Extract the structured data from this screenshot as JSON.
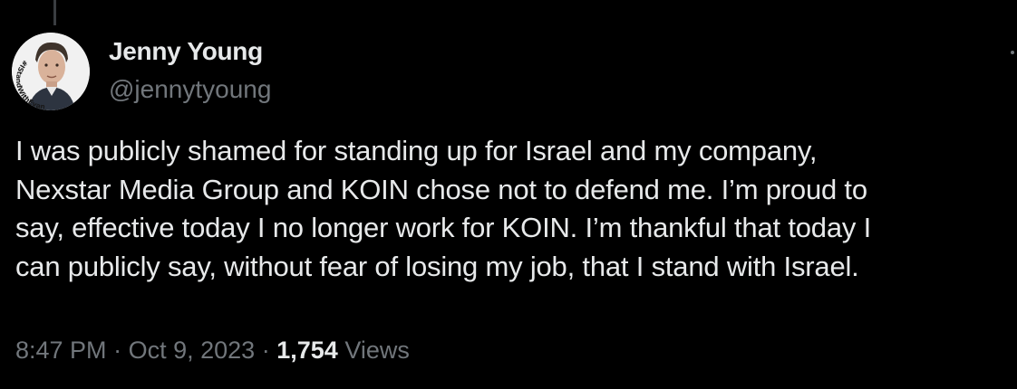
{
  "tweet": {
    "author": {
      "display_name": "Jenny Young",
      "handle": "@jennytyoung",
      "avatar_badge_text": "#IStandWithEvan"
    },
    "text_lines": [
      "I was publicly shamed for standing up for Israel and my company,",
      "Nexstar Media Group and KOIN chose not to defend me. I’m proud to",
      "say, effective today I no longer work for KOIN. I’m thankful that today I",
      "can publicly say, without fear of losing my job, that I stand with Israel."
    ],
    "meta": {
      "time": "8:47 PM",
      "separator": "·",
      "date": "Oct 9, 2023",
      "views_count": "1,754",
      "views_label": "Views"
    }
  },
  "icons": {
    "more": "more-options-icon"
  },
  "colors": {
    "background": "#000000",
    "primary_text": "#e7e9ea",
    "secondary_text": "#71767b"
  }
}
